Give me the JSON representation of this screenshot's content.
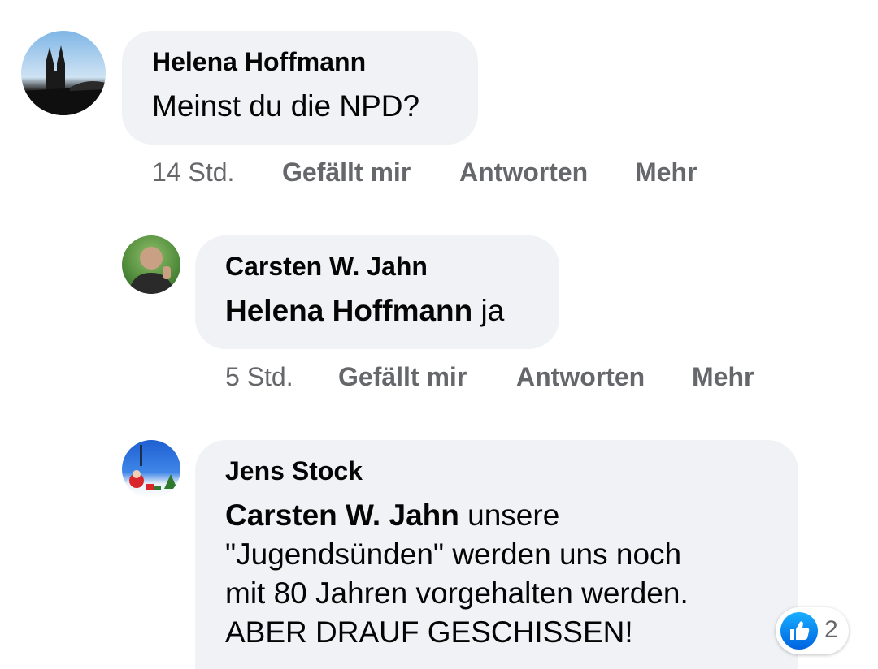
{
  "comments": [
    {
      "author": "Helena Hoffmann",
      "text": "Meinst du die NPD?",
      "time": "14 Std.",
      "actions": [
        "Gefällt mir",
        "Antworten",
        "Mehr"
      ]
    },
    {
      "author": "Carsten W. Jahn",
      "mention": "Helena Hoffmann",
      "text": " ja",
      "time": "5 Std.",
      "actions": [
        "Gefällt mir",
        "Antworten",
        "Mehr"
      ]
    },
    {
      "author": "Jens Stock",
      "mention": "Carsten W. Jahn",
      "text_lines": [
        " unsere",
        "\"Jugendsünden\" werden uns noch",
        "mit 80 Jahren vorgehalten werden.",
        "ABER DRAUF GESCHISSEN!"
      ],
      "reaction": {
        "icon": "like-icon",
        "count": "2"
      }
    }
  ],
  "colors": {
    "bubble": "#f0f2f5",
    "meta": "#65676b",
    "like_blue": "#1877f2"
  }
}
